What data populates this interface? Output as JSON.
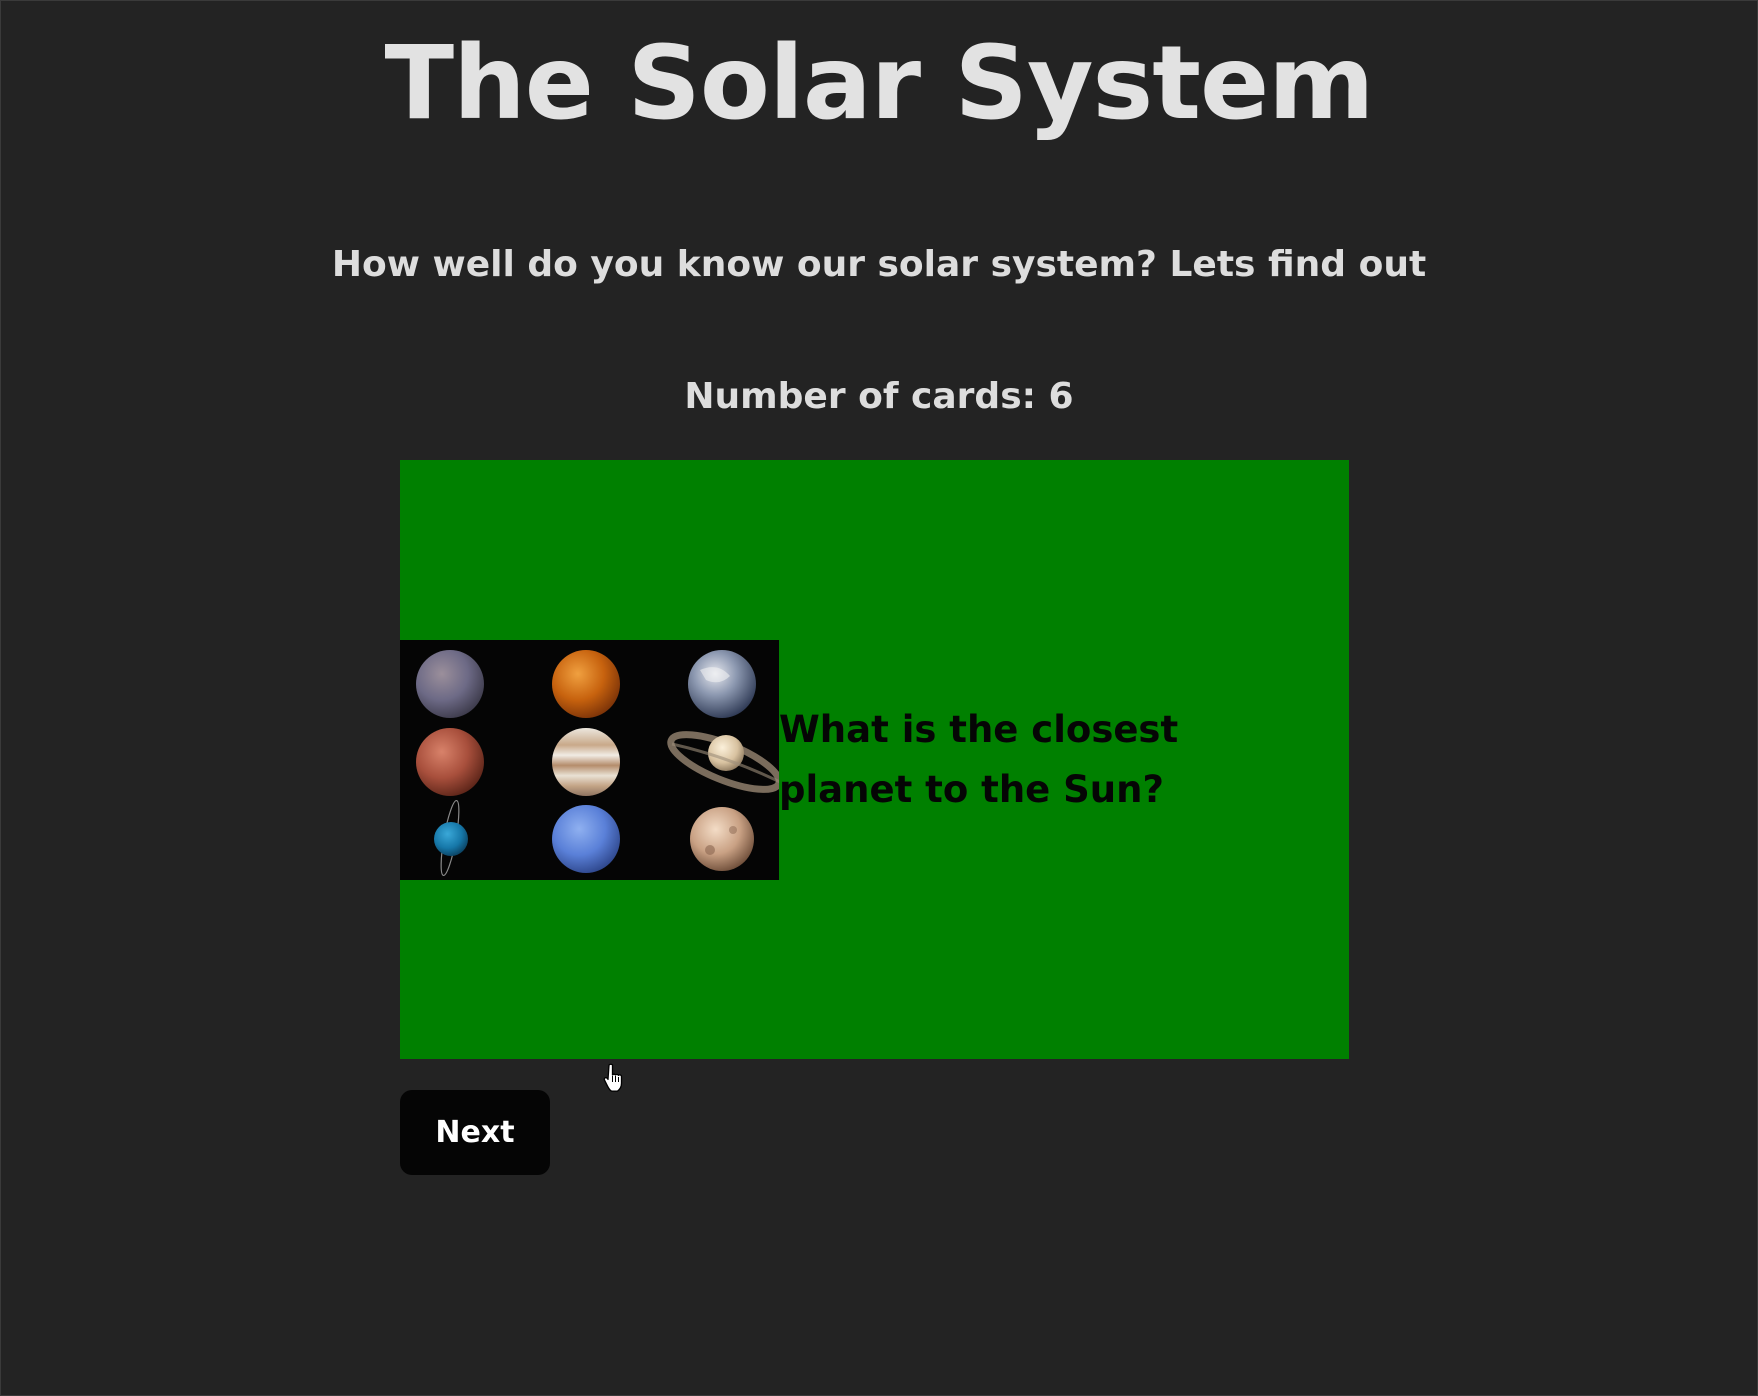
{
  "header": {
    "title": "The Solar System",
    "subtitle": "How well do you know our solar system? Lets find out",
    "card_count_label": "Number of cards: 6"
  },
  "card": {
    "background_color": "#008000",
    "question": "What is the closest planet to the Sun?",
    "image_icon": "planets-grid-image"
  },
  "controls": {
    "next_label": "Next"
  },
  "cursor": {
    "icon": "hand-pointer-icon"
  }
}
